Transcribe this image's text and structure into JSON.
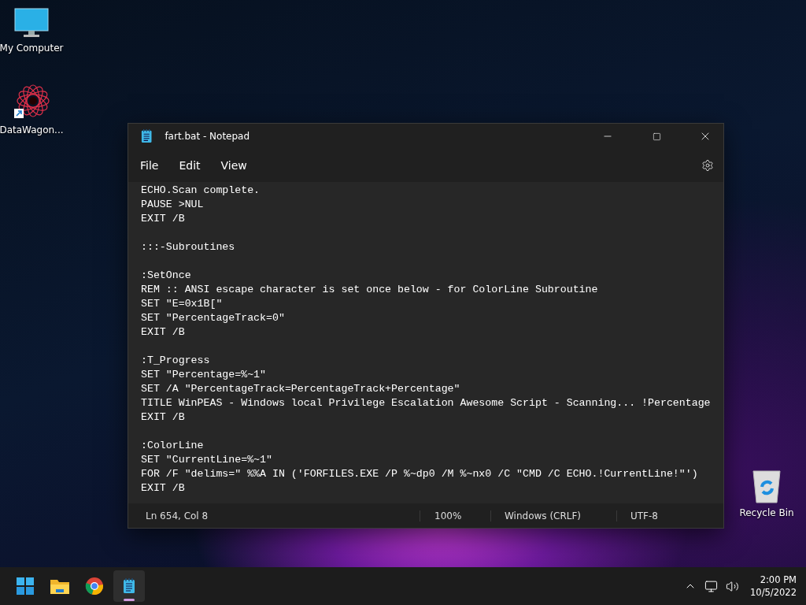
{
  "desktop_icons": [
    {
      "kind": "computer",
      "label": "My Computer"
    },
    {
      "kind": "shortcut",
      "label": "DataWagon..."
    },
    {
      "kind": "recycle",
      "label": "Recycle Bin"
    }
  ],
  "window": {
    "title": "fart.bat - Notepad",
    "menu": [
      "File",
      "Edit",
      "View"
    ],
    "code_blocks": [
      [
        "ECHO.Scan complete.",
        "PAUSE >NUL",
        "EXIT /B"
      ],
      [
        ":::-Subroutines"
      ],
      [
        ":SetOnce",
        "REM :: ANSI escape character is set once below - for ColorLine Subroutine",
        "SET \"E=0x1B[\"",
        "SET \"PercentageTrack=0\"",
        "EXIT /B"
      ],
      [
        ":T_Progress",
        "SET \"Percentage=%~1\"",
        "SET /A \"PercentageTrack=PercentageTrack+Percentage\"",
        "TITLE WinPEAS - Windows local Privilege Escalation Awesome Script - Scanning... !Percentage",
        "EXIT /B"
      ],
      [
        ":ColorLine",
        "SET \"CurrentLine=%~1\"",
        "FOR /F \"delims=\" %%A IN ('FORFILES.EXE /P %~dp0 /M %~nx0 /C \"CMD /C ECHO.!CurrentLine!\"')",
        "EXIT /B"
      ]
    ],
    "status_bar": {
      "position": "Ln 654, Col 8",
      "zoom": "100%",
      "line_ending": "Windows (CRLF)",
      "encoding": "UTF-8"
    }
  },
  "taskbar": {
    "apps": [
      {
        "kind": "start",
        "selected": false
      },
      {
        "kind": "folder",
        "selected": false
      },
      {
        "kind": "browser",
        "selected": false
      },
      {
        "kind": "notepad",
        "selected": true
      }
    ],
    "time": "2:00 PM",
    "date": "10/5/2022"
  }
}
